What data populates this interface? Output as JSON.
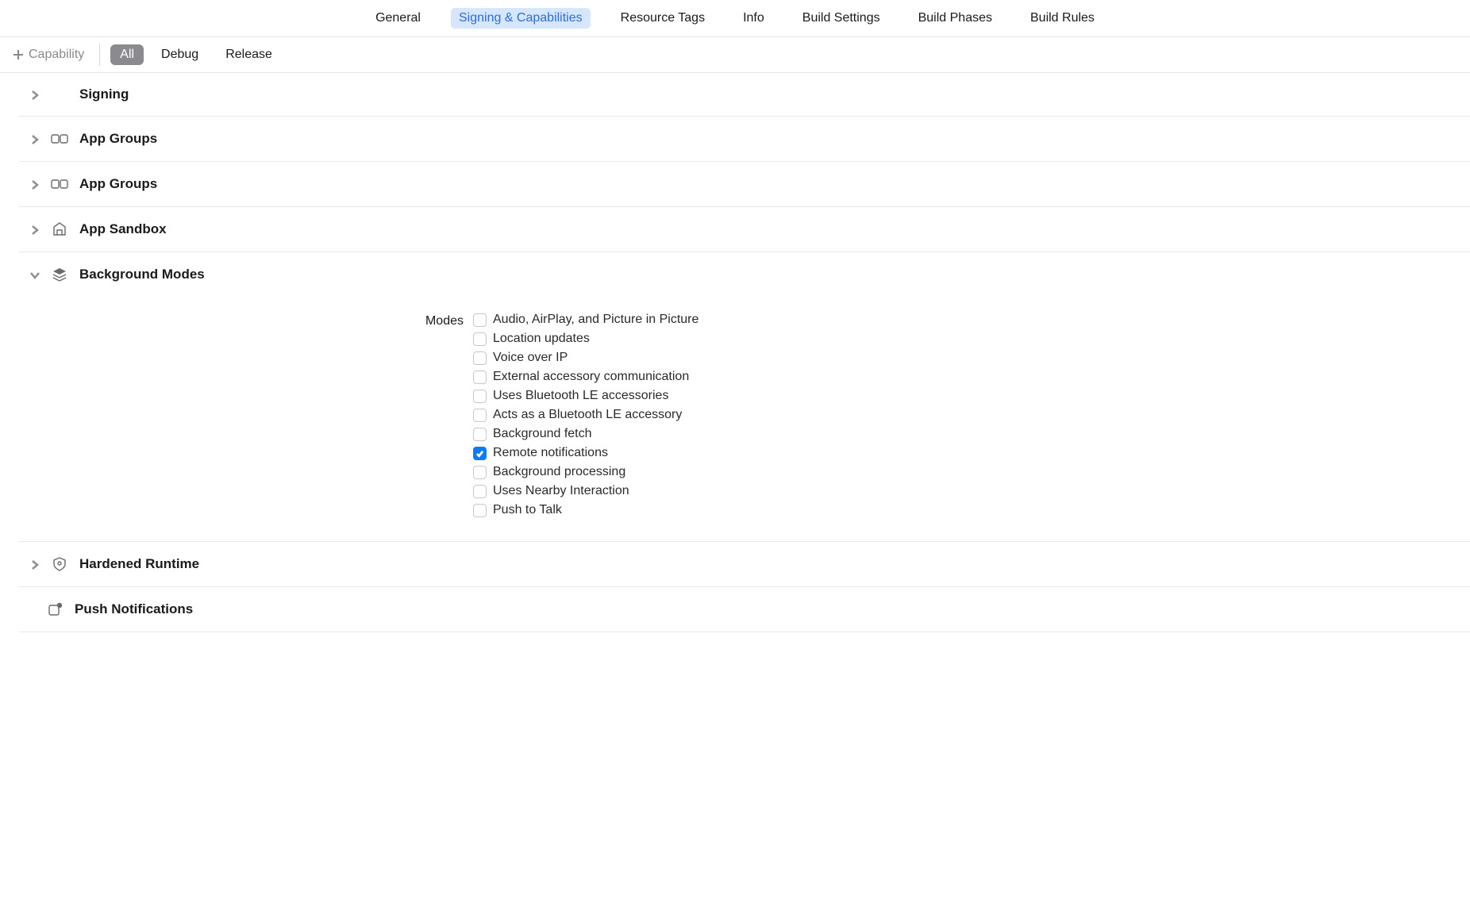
{
  "topTabs": {
    "general": "General",
    "signing": "Signing & Capabilities",
    "resourceTags": "Resource Tags",
    "info": "Info",
    "buildSettings": "Build Settings",
    "buildPhases": "Build Phases",
    "buildRules": "Build Rules",
    "active": "signing"
  },
  "toolbar": {
    "addCapability": "Capability",
    "configTabs": {
      "all": "All",
      "debug": "Debug",
      "release": "Release",
      "active": "all"
    }
  },
  "sections": {
    "signing": {
      "title": "Signing",
      "expanded": false
    },
    "appGroups1": {
      "title": "App Groups",
      "expanded": false
    },
    "appGroups2": {
      "title": "App Groups",
      "expanded": false
    },
    "appSandbox": {
      "title": "App Sandbox",
      "expanded": false
    },
    "backgroundModes": {
      "title": "Background Modes",
      "expanded": true,
      "modesLabel": "Modes",
      "modes": [
        {
          "label": "Audio, AirPlay, and Picture in Picture",
          "checked": false
        },
        {
          "label": "Location updates",
          "checked": false
        },
        {
          "label": "Voice over IP",
          "checked": false
        },
        {
          "label": "External accessory communication",
          "checked": false
        },
        {
          "label": "Uses Bluetooth LE accessories",
          "checked": false
        },
        {
          "label": "Acts as a Bluetooth LE accessory",
          "checked": false
        },
        {
          "label": "Background fetch",
          "checked": false
        },
        {
          "label": "Remote notifications",
          "checked": true
        },
        {
          "label": "Background processing",
          "checked": false
        },
        {
          "label": "Uses Nearby Interaction",
          "checked": false
        },
        {
          "label": "Push to Talk",
          "checked": false
        }
      ]
    },
    "hardenedRuntime": {
      "title": "Hardened Runtime",
      "expanded": false
    },
    "pushNotifications": {
      "title": "Push Notifications",
      "expanded": false
    }
  }
}
